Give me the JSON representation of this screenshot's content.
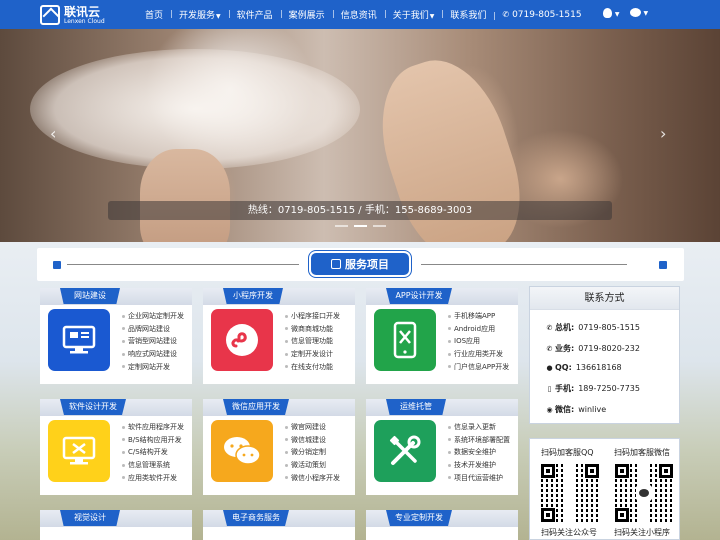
{
  "nav": {
    "logo_cn": "联讯云",
    "logo_en": "Lenxen Cloud",
    "items": [
      {
        "label": "首页"
      },
      {
        "label": "开发服务",
        "dropdown": true
      },
      {
        "label": "软件产品"
      },
      {
        "label": "案例展示"
      },
      {
        "label": "信息资讯"
      },
      {
        "label": "关于我们",
        "dropdown": true
      },
      {
        "label": "联系我们"
      }
    ],
    "phone": "0719-805-1515",
    "icons": [
      "qq-icon",
      "wechat-icon"
    ]
  },
  "banner": {
    "hotline": "热线：0719-805-1515 / 手机：155-8689-3003",
    "slides": 3,
    "active_slide": 2
  },
  "section": {
    "title": "服务项目"
  },
  "services": [
    {
      "title": "网站建设",
      "icon": "monitor-icon",
      "color": "#1a59d1",
      "items": [
        "企业网站定制开发",
        "品牌网站建设",
        "营销型网站建设",
        "响应式网站建设",
        "定制网站开发"
      ]
    },
    {
      "title": "小程序开发",
      "icon": "mini-program-icon",
      "color": "#e8354a",
      "items": [
        "小程序接口开发",
        "微商商城功能",
        "信息管理功能",
        "定制开发设计",
        "在线支付功能"
      ]
    },
    {
      "title": "APP设计开发",
      "icon": "phone-tools-icon",
      "color": "#22a44a",
      "items": [
        "手机移端APP",
        "Android应用",
        "IOS应用",
        "行业应用类开发",
        "门户信息APP开发"
      ]
    },
    {
      "title": "软件设计开发",
      "icon": "monitor-tools-icon",
      "color": "#ffd11a",
      "items": [
        "软件应用程序开发",
        "B/S结构应用开发",
        "C/S结构开发",
        "信息管理系统",
        "应用类软件开发"
      ]
    },
    {
      "title": "微信应用开发",
      "icon": "chat-bubbles-icon",
      "color": "#f6a81d",
      "items": [
        "微官网建设",
        "微信城建设",
        "微分销定制",
        "微活动策划",
        "微信小程序开发"
      ]
    },
    {
      "title": "运维托管",
      "icon": "wrench-screwdriver-icon",
      "color": "#1ea05b",
      "items": [
        "信息录入更新",
        "系统环境部署配置",
        "数据安全维护",
        "技术开发维护",
        "项目代运营维护"
      ]
    },
    {
      "title": "视觉设计",
      "icon": "",
      "color": "#1a59d1",
      "items": []
    },
    {
      "title": "电子商务服务",
      "icon": "",
      "color": "#e8354a",
      "items": []
    },
    {
      "title": "专业定制开发",
      "icon": "",
      "color": "#22a44a",
      "items": []
    }
  ],
  "contact": {
    "title": "联系方式",
    "rows": [
      {
        "label": "总机:",
        "value": "0719-805-1515",
        "icon": "phone-icon"
      },
      {
        "label": "业务:",
        "value": "0719-8020-232",
        "icon": "phone-icon"
      },
      {
        "label": "QQ:",
        "value": "136618168",
        "icon": "qq-icon"
      },
      {
        "label": "手机:",
        "value": "189-7250-7735",
        "icon": "mobile-icon"
      },
      {
        "label": "微信:",
        "value": "winlive",
        "icon": "wechat-icon"
      }
    ]
  },
  "qr": {
    "qq_title": "扫码加客服QQ",
    "wx_title": "扫码加客服微信",
    "qq_caption": "扫码关注公众号",
    "wx_caption": "扫码关注小程序"
  },
  "colors": {
    "primary": "#1f62c9"
  }
}
